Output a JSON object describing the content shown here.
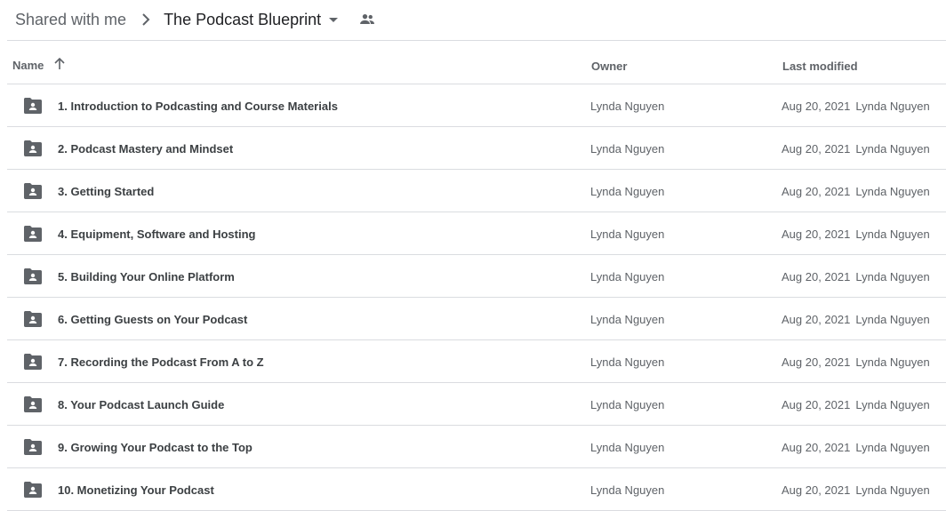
{
  "breadcrumb": {
    "root": "Shared with me",
    "current": "The Podcast Blueprint"
  },
  "table": {
    "headers": {
      "name": "Name",
      "owner": "Owner",
      "modified": "Last modified"
    },
    "rows": [
      {
        "name": "1. Introduction to Podcasting and Course Materials",
        "owner": "Lynda Nguyen",
        "date": "Aug 20, 2021",
        "by": "Lynda Nguyen"
      },
      {
        "name": "2. Podcast Mastery and Mindset",
        "owner": "Lynda Nguyen",
        "date": "Aug 20, 2021",
        "by": "Lynda Nguyen"
      },
      {
        "name": "3. Getting Started",
        "owner": "Lynda Nguyen",
        "date": "Aug 20, 2021",
        "by": "Lynda Nguyen"
      },
      {
        "name": "4. Equipment, Software and Hosting",
        "owner": "Lynda Nguyen",
        "date": "Aug 20, 2021",
        "by": "Lynda Nguyen"
      },
      {
        "name": "5. Building Your Online Platform",
        "owner": "Lynda Nguyen",
        "date": "Aug 20, 2021",
        "by": "Lynda Nguyen"
      },
      {
        "name": "6. Getting Guests on Your Podcast",
        "owner": "Lynda Nguyen",
        "date": "Aug 20, 2021",
        "by": "Lynda Nguyen"
      },
      {
        "name": "7. Recording the Podcast From A to Z",
        "owner": "Lynda Nguyen",
        "date": "Aug 20, 2021",
        "by": "Lynda Nguyen"
      },
      {
        "name": "8. Your Podcast Launch Guide",
        "owner": "Lynda Nguyen",
        "date": "Aug 20, 2021",
        "by": "Lynda Nguyen"
      },
      {
        "name": "9. Growing Your Podcast to the Top",
        "owner": "Lynda Nguyen",
        "date": "Aug 20, 2021",
        "by": "Lynda Nguyen"
      },
      {
        "name": "10. Monetizing Your Podcast",
        "owner": "Lynda Nguyen",
        "date": "Aug 20, 2021",
        "by": "Lynda Nguyen"
      }
    ]
  },
  "icons": {
    "row_icon": "shared-folder-icon",
    "sort": "arrow-up-icon",
    "breadcrumb_separator": "chevron-right-icon",
    "dropdown": "caret-down-icon",
    "shared": "people-icon"
  },
  "colors": {
    "folder": "#5f6368",
    "divider": "#dadce0",
    "text_primary": "#202124",
    "text_secondary": "#5f6368"
  }
}
